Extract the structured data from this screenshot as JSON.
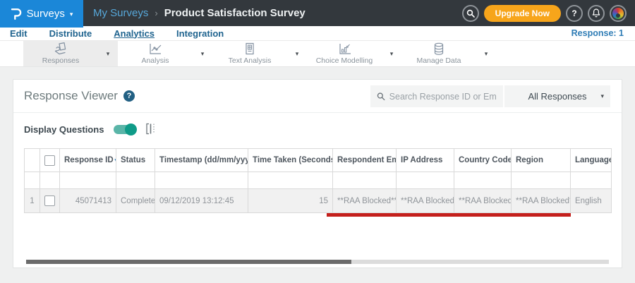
{
  "topbar": {
    "product": "Surveys",
    "caret": "▾",
    "breadcrumb": {
      "parent": "My Surveys",
      "separator": "›",
      "current": "Product Satisfaction Survey"
    },
    "upgrade_label": "Upgrade Now",
    "help_glyph": "?"
  },
  "nav": {
    "items": [
      {
        "label": "Edit"
      },
      {
        "label": "Distribute"
      },
      {
        "label": "Analytics"
      },
      {
        "label": "Integration"
      }
    ],
    "active_item": "Analytics",
    "response_count": "Response: 1"
  },
  "toolbar": {
    "caret": "▾",
    "items": [
      {
        "label": "Responses"
      },
      {
        "label": "Analysis"
      },
      {
        "label": "Text Analysis"
      },
      {
        "label": "Choice Modelling"
      },
      {
        "label": "Manage Data"
      }
    ],
    "active_item": "Responses"
  },
  "viewer": {
    "title": "Response Viewer",
    "help_glyph": "?",
    "search_placeholder": "Search Response ID or Email",
    "responses_filter": "All Responses",
    "display_questions": "Display Questions",
    "toggle_state": "on"
  },
  "table": {
    "sort_caret": "▾",
    "sort_updown": "⇅",
    "headers": {
      "response_id": "Response ID",
      "status": "Status",
      "timestamp": "Timestamp (dd/mm/yyyy)",
      "time_taken": "Time Taken (Seconds)",
      "email": "Respondent Email",
      "ip": "IP Address",
      "country": "Country Code",
      "region": "Region",
      "language": "Language"
    },
    "rows": [
      {
        "num": "1",
        "response_id": "45071413",
        "status": "Completed",
        "timestamp": "09/12/2019 13:12:45",
        "time_taken": "15",
        "email": "**RAA Blocked**",
        "ip": "**RAA Blocked**",
        "country": "**RAA Blocked**",
        "region": "**RAA Blocked**",
        "language": "English"
      }
    ]
  },
  "colors": {
    "brand_blue": "#1b87d8",
    "topbar_dark": "#33383d",
    "accent_orange": "#f7a51b",
    "link_blue": "#2e7cb5",
    "toggle_teal": "#0f9b88",
    "annotation_red": "#c4201c"
  }
}
